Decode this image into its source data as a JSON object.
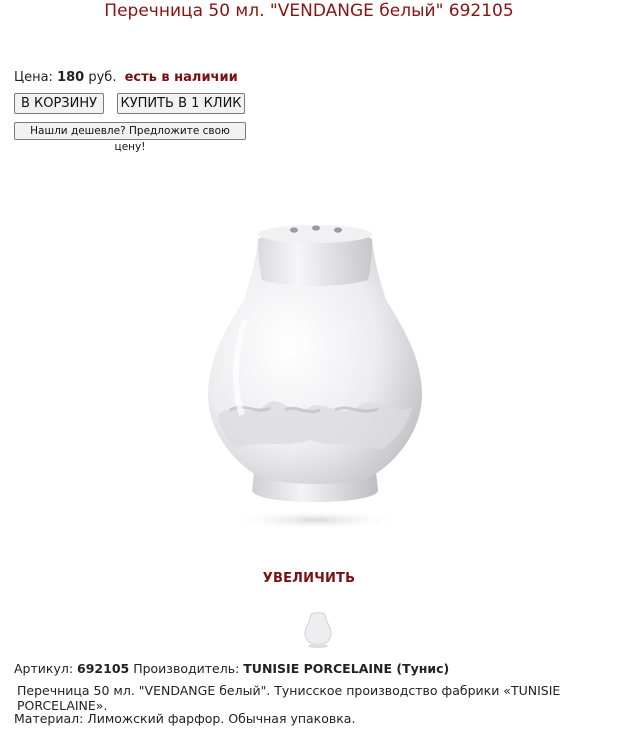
{
  "title": "Перечница 50 мл. \"VENDANGE белый\" 692105",
  "price": {
    "label": "Цена:",
    "amount": "180",
    "currency": "руб.",
    "availability": "есть в наличии"
  },
  "buttons": {
    "cart": "В КОРЗИНУ",
    "one_click": "КУПИТЬ В 1 КЛИК",
    "cheaper": "Нашли дешевле? Предложите свою цену!"
  },
  "image": {
    "zoom_label": "УВЕЛИЧИТЬ"
  },
  "details": {
    "article_label": "Артикул:",
    "article_value": "692105",
    "maker_label": "Производитель:",
    "maker_value": "TUNISIE PORCELAINE (Тунис)",
    "description": "Перечница 50 мл. \"VENDANGE белый\". Тунисское производство фабрики «TUNISIE PORCELAINE».",
    "material": "Материал: Лиможский фарфор. Обычная упаковка."
  }
}
